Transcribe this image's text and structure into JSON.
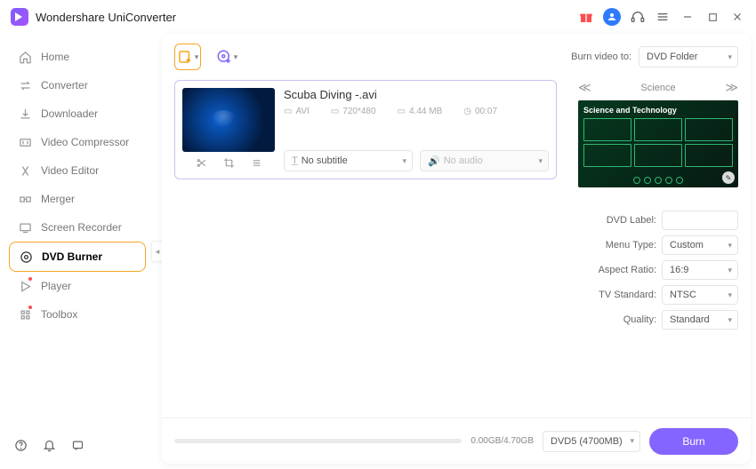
{
  "app": {
    "title": "Wondershare UniConverter"
  },
  "sidebar": {
    "items": [
      {
        "label": "Home",
        "icon": "home-icon"
      },
      {
        "label": "Converter",
        "icon": "converter-icon"
      },
      {
        "label": "Downloader",
        "icon": "downloader-icon"
      },
      {
        "label": "Video Compressor",
        "icon": "compressor-icon"
      },
      {
        "label": "Video Editor",
        "icon": "editor-icon"
      },
      {
        "label": "Merger",
        "icon": "merger-icon"
      },
      {
        "label": "Screen Recorder",
        "icon": "recorder-icon"
      },
      {
        "label": "DVD Burner",
        "icon": "dvd-burner-icon"
      },
      {
        "label": "Player",
        "icon": "player-icon"
      },
      {
        "label": "Toolbox",
        "icon": "toolbox-icon"
      }
    ]
  },
  "toolbar": {
    "burn_to_label": "Burn video to:",
    "burn_to_value": "DVD Folder"
  },
  "file": {
    "name": "Scuba Diving -.avi",
    "format": "AVI",
    "resolution": "720*480",
    "size": "4.44 MB",
    "duration": "00:07",
    "subtitle_value": "No subtitle",
    "audio_value": "No audio"
  },
  "template": {
    "name": "Science",
    "title": "Science and Technology"
  },
  "settings": {
    "dvd_label_key": "DVD Label:",
    "dvd_label_value": "",
    "menu_type_key": "Menu Type:",
    "menu_type_value": "Custom",
    "aspect_ratio_key": "Aspect Ratio:",
    "aspect_ratio_value": "16:9",
    "tv_standard_key": "TV Standard:",
    "tv_standard_value": "NTSC",
    "quality_key": "Quality:",
    "quality_value": "Standard"
  },
  "bottom": {
    "size": "0.00GB/4.70GB",
    "disc_value": "DVD5 (4700MB)",
    "burn_label": "Burn"
  }
}
